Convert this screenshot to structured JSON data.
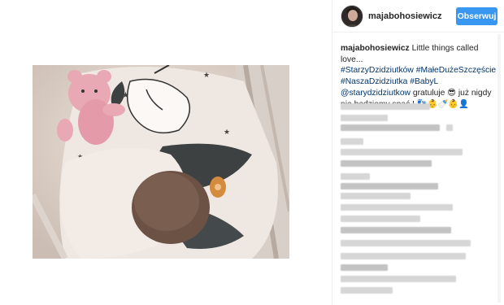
{
  "post": {
    "username": "majabohosiewicz",
    "follow_label": "Obserwuj"
  },
  "caption": {
    "username": "majabohosiewicz",
    "text1": "Little things called love...",
    "hashtags": [
      "#StarzyDzidziutków",
      "#MałeDużeSzczęście",
      "#NaszaDzidziutka",
      "#BabyL"
    ],
    "mention": "@starydzidziutkow",
    "text2": "gratuluje 😎 już nigdy nie będziemy spać ! 👣👶🍼👶👤"
  },
  "colors": {
    "accent": "#3897f0",
    "link": "#003569"
  },
  "icons": {
    "avatar": "profile-photo"
  }
}
